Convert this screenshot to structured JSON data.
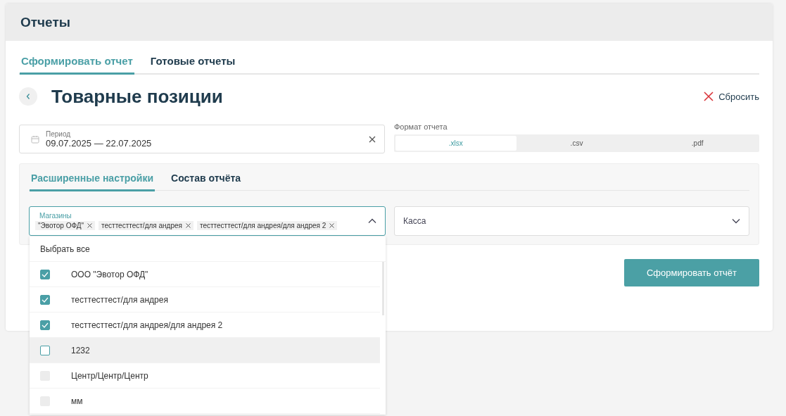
{
  "page": {
    "title": "Отчеты"
  },
  "tabs": [
    {
      "label": "Сформировать отчет",
      "selected": true
    },
    {
      "label": "Готовые отчеты",
      "selected": false
    }
  ],
  "report": {
    "title": "Товарные позиции",
    "reset": "Сбросить"
  },
  "period": {
    "label": "Период",
    "value": "09.07.2025 — 22.07.2025"
  },
  "format": {
    "label": "Формат отчета",
    "options": [
      {
        "label": ".xlsx",
        "selected": true
      },
      {
        "label": ".csv",
        "selected": false
      },
      {
        "label": ".pdf",
        "selected": false
      }
    ]
  },
  "settings_tabs": [
    {
      "label": "Расширенные настройки",
      "selected": true
    },
    {
      "label": "Состав отчёта",
      "selected": false
    }
  ],
  "shops": {
    "label": "Магазины",
    "expanded": true,
    "chips": [
      "\"Эвотор ОФД\"",
      "тесттесттест/для андрея",
      "тесттесттест/для андрея/для андрея 2"
    ]
  },
  "cashbox": {
    "placeholder": "Касса"
  },
  "submit": "Сформировать отчёт",
  "dropdown": {
    "select_all": "Выбрать все",
    "items": [
      {
        "label": "ООО \"Эвотор ОФД\"",
        "checked": true,
        "disabled": false,
        "highlighted": false
      },
      {
        "label": "тесттесттест/для андрея",
        "checked": true,
        "disabled": false,
        "highlighted": false
      },
      {
        "label": "тесттесттест/для андрея/для андрея 2",
        "checked": true,
        "disabled": false,
        "highlighted": false
      },
      {
        "label": "1232",
        "checked": false,
        "disabled": false,
        "highlighted": true
      },
      {
        "label": "Центр/Центр/Центр",
        "checked": false,
        "disabled": true,
        "highlighted": false
      },
      {
        "label": "мм",
        "checked": false,
        "disabled": true,
        "highlighted": false
      }
    ]
  }
}
